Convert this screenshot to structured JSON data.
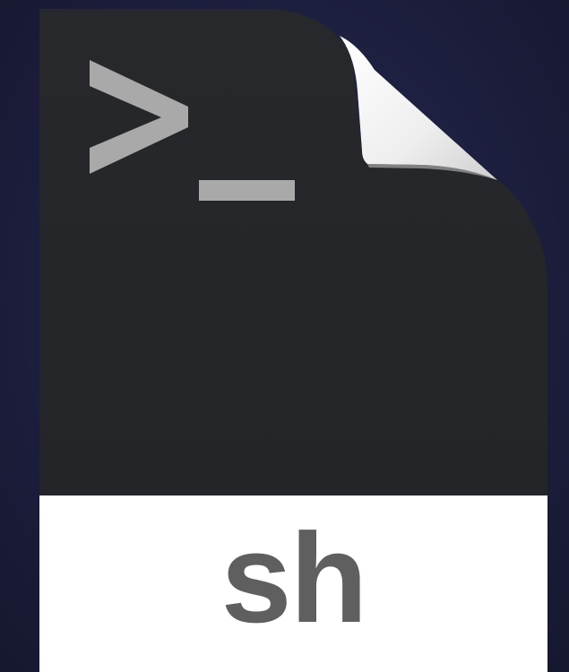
{
  "icon": {
    "type": "document-icon",
    "glyph": "terminal-prompt-icon",
    "extension": "sh",
    "colors": {
      "background": "#1f2143",
      "document_body": "#25272b",
      "page_curl": "#f4f4f4",
      "prompt_glyph": "#a9a9a9",
      "extension_band": "#ffffff",
      "extension_text": "#5f5f5f"
    }
  }
}
